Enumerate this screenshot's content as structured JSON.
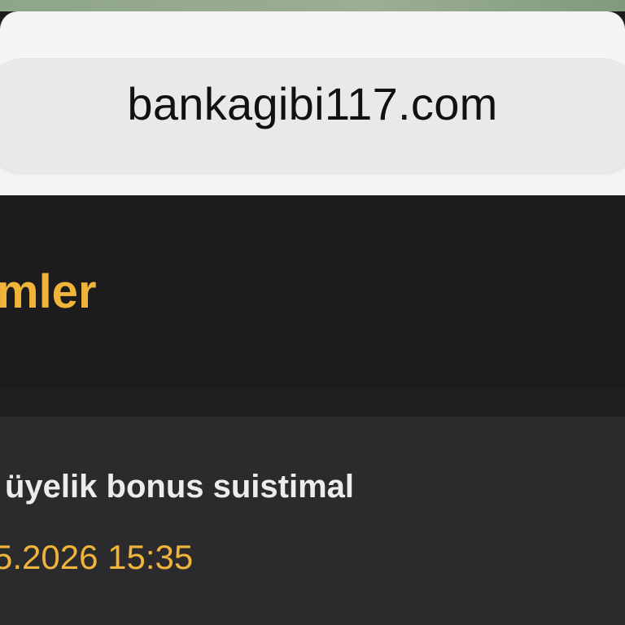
{
  "browser": {
    "url": "bankagibi117.com"
  },
  "header": {
    "title": "mler"
  },
  "card": {
    "title": "üyelik bonus suistimal",
    "date": "5.2026 15:35"
  },
  "colors": {
    "accent": "#f0b43a",
    "background": "#1c1c1e",
    "card_background": "#2b2b2d",
    "address_bar": "#e9e9ea"
  }
}
